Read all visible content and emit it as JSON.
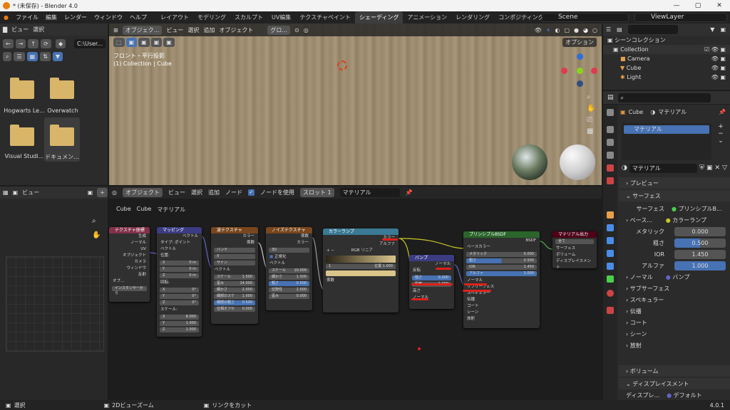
{
  "window": {
    "title": "* (未保存) - Blender 4.0",
    "min": "—",
    "max": "▢",
    "close": "✕"
  },
  "menu": [
    "ファイル",
    "編集",
    "レンダー",
    "ウィンドウ",
    "ヘルプ"
  ],
  "workspaces": [
    "レイアウト",
    "モデリング",
    "スカルプト",
    "UV編集",
    "テクスチャペイント",
    "シェーディング",
    "アニメーション",
    "レンダリング",
    "コンポジティング"
  ],
  "active_workspace": "シェーディング",
  "scene": "Scene",
  "view_layer": "ViewLayer",
  "filebrowser": {
    "menus": [
      "ビュー",
      "選択"
    ],
    "path": "C:\\User...",
    "items": [
      "Hogwarts Le...",
      "Overwatch",
      "Visual Studi...",
      "ドキュメン..."
    ]
  },
  "viewport": {
    "mode": "オブジェク...",
    "menus": [
      "ビュー",
      "選択",
      "追加",
      "オブジェクト"
    ],
    "orient": "グロ...",
    "info1": "フロント・平行投影",
    "info2": "(1) Collection | Cube",
    "option": "オプション"
  },
  "image_editor": {
    "menu": "ビュー"
  },
  "node_editor": {
    "mode": "オブジェクト",
    "menus": [
      "ビュー",
      "選択",
      "追加",
      "ノード"
    ],
    "use_nodes": "ノードを使用",
    "slot": "スロット 1",
    "material": "マテリアル",
    "breadcrumb": [
      "Cube",
      "Cube",
      "マテリアル"
    ]
  },
  "nodes": {
    "texcoord": {
      "title": "テクスチャ座標",
      "outs": [
        "生成",
        "ノーマル",
        "UV",
        "オブジェクト",
        "カメラ",
        "ウィンドウ",
        "反射"
      ],
      "obj": "オブ...",
      "inst": "インスタンサーから"
    },
    "mapping": {
      "title": "マッピング",
      "out": "ベクトル",
      "type": "タイプ:",
      "type_val": "ポイント",
      "vec": "ベクトル",
      "loc": "位置:",
      "rot": "回転:",
      "scale": "スケール:",
      "xyz": [
        "X",
        "Y",
        "Z"
      ],
      "loc_v": [
        "0 m",
        "0 m",
        "0 m"
      ],
      "rot_v": [
        "0°",
        "0°",
        "0°"
      ],
      "scale_v": [
        "8.000",
        "1.000",
        "1.000"
      ]
    },
    "wave": {
      "title": "波テクスチャ",
      "outs": [
        "カラー",
        "係数"
      ],
      "opts": [
        "バンド",
        "X",
        "サイン"
      ],
      "vec": "ベクトル",
      "fields": [
        [
          "スケール",
          "1.500"
        ],
        [
          "歪み",
          "14.000"
        ],
        [
          "細かさ",
          "2.000"
        ],
        [
          "細部のスケ",
          "1.000"
        ],
        [
          "細部の粗さ",
          "0.500"
        ],
        [
          "位相オフセ",
          "0.000"
        ]
      ]
    },
    "noise": {
      "title": "ノイズテクスチャ",
      "outs": [
        "係数",
        "カラー"
      ],
      "dim": "3D",
      "norm": "正規化",
      "vec": "ベクトル",
      "fields": [
        [
          "スケール",
          "10.000"
        ],
        [
          "細かさ",
          "1.500"
        ],
        [
          "粗さ",
          "0.500"
        ],
        [
          "空隙性",
          "2.000"
        ],
        [
          "歪み",
          "0.000"
        ]
      ]
    },
    "ramp": {
      "title": "カラーランプ",
      "outs": [
        "カラー",
        "アルファ"
      ],
      "mode": "RGB",
      "interp": "リニア",
      "idx": "1",
      "pos_label": "位置",
      "pos": "1.000",
      "fac": "係数",
      "plus": "+",
      "minus": "−"
    },
    "bump": {
      "title": "バンプ",
      "out": "ノーマル",
      "invert": "反転",
      "fields": [
        [
          "強さ",
          "0.200"
        ],
        [
          "距離",
          "1.000"
        ]
      ],
      "height": "高さ",
      "normal": "ノーマル"
    },
    "bsdf": {
      "title": "プリンシプルBSDF",
      "out": "BSDF",
      "base": "ベースカラー",
      "fields": [
        [
          "メタリック",
          "0.000"
        ],
        [
          "粗さ",
          "0.500"
        ],
        [
          "IOR",
          "1.450"
        ],
        [
          "アルファ",
          "1.000"
        ]
      ],
      "normal": "ノーマル",
      "subs": [
        "サブサーフェス",
        "スペキュラー",
        "伝播",
        "コート",
        "シーン",
        "放射"
      ]
    },
    "output": {
      "title": "マテリアル出力",
      "target": "全て",
      "ins": [
        "サーフェス",
        "ボリューム",
        "ディスプレイスメント"
      ]
    }
  },
  "outliner": {
    "search": "",
    "root": "シーンコレクション",
    "collection": "Collection",
    "items": [
      "Camera",
      "Cube",
      "Light"
    ]
  },
  "properties": {
    "object": "Cube",
    "mat_tab": "マテリアル",
    "slot": "マテリアル",
    "material": "マテリアル",
    "preview": "プレビュー",
    "surface": "サーフェス",
    "surface_label": "サーフェス",
    "shader": "プリンシプルB...",
    "base": "ベース...",
    "base_val": "カラーランプ",
    "rows": [
      [
        "メタリック",
        "0.000"
      ],
      [
        "粗さ",
        "0.500"
      ],
      [
        "IOR",
        "1.450"
      ],
      [
        "アルファ",
        "1.000"
      ]
    ],
    "normal": "ノーマル",
    "normal_val": "バンプ",
    "subs": [
      "サブサーフェス",
      "スペキュラー",
      "伝播",
      "コート",
      "シーン",
      "放射"
    ],
    "volume": "ボリューム",
    "displace": "ディスプレイスメント",
    "disp_label": "ディスプレ...",
    "disp_val": "デフォルト"
  },
  "status": {
    "select": "選択",
    "zoom": "2Dビューズーム",
    "cut": "リンクをカット",
    "version": "4.0.1"
  },
  "colors": {
    "accent": "#4772b3",
    "node_input": "#83314a",
    "node_vector": "#3c3c83",
    "node_texture": "#79461d",
    "node_converter": "#3b7a94",
    "node_shader": "#2b652b",
    "node_output": "#4d0017"
  }
}
